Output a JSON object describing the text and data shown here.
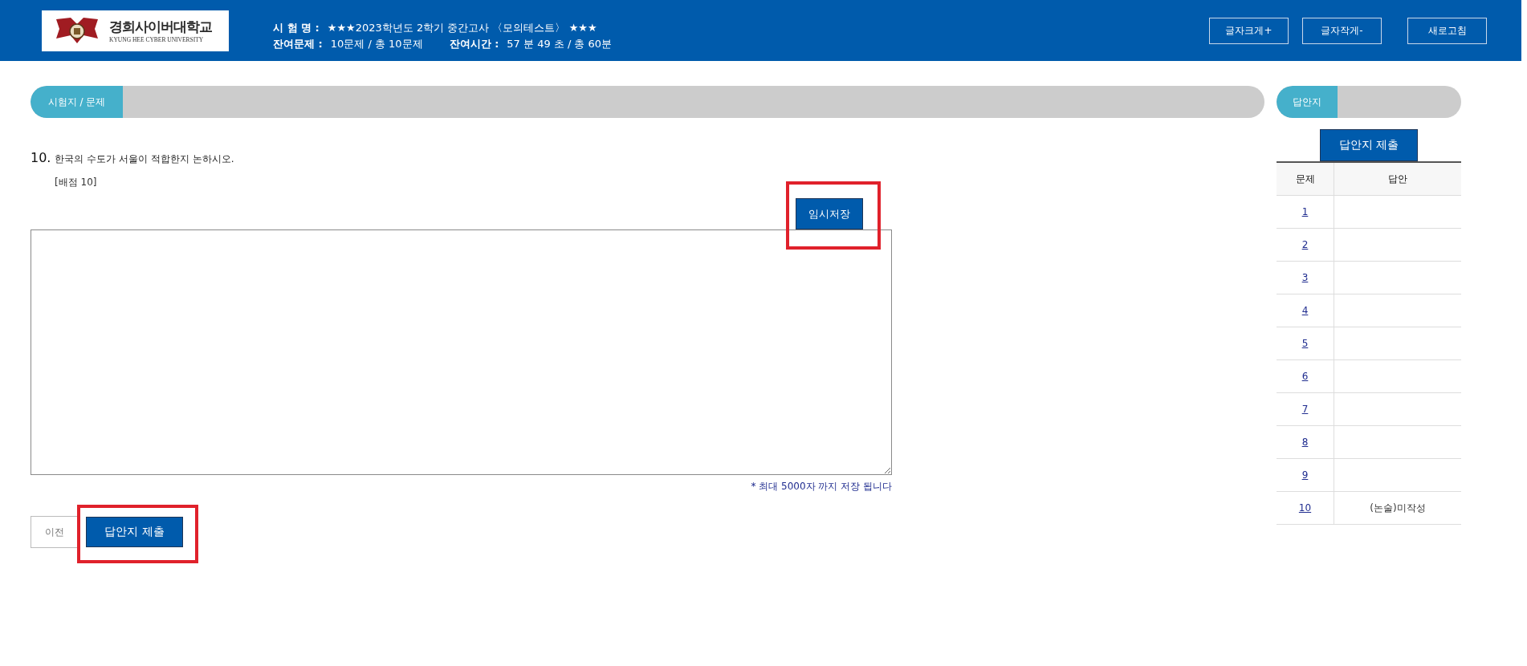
{
  "header": {
    "university_name": "경희사이버대학교",
    "university_name_en": "KYUNG HEE CYBER UNIVERSITY",
    "exam_label": "시 험 명 :",
    "exam_name": "★★★2023학년도 2학기 중간고사 〈모의테스트〉 ★★★",
    "remaining_questions_label": "잔여문제 :",
    "remaining_questions": "10문제 / 총 10문제",
    "remaining_time_label": "잔여시간 :",
    "remaining_time": "57 분 49 초 / 총 60분",
    "buttons": [
      {
        "label": "글자크게+"
      },
      {
        "label": "글자작게-"
      },
      {
        "label": "새로고침"
      }
    ]
  },
  "question_panel": {
    "tab": "시험지 / 문제",
    "number": "10.",
    "text": "한국의 수도가 서울이 적합한지 논하시오.",
    "points": "[배점 10]",
    "save_button": {
      "label": "임시저장",
      "highlighted": true
    },
    "note": "* 최대 5000자 까지 저장 됩니다",
    "prev_button": {
      "label": "이전"
    },
    "submit_button": {
      "label": "답안지 제출",
      "highlighted": true
    }
  },
  "answer_sheet": {
    "tab": "답안지",
    "submit_button": {
      "label": "답안지 제출"
    },
    "columns": [
      "문제",
      "답안"
    ],
    "rows": [
      {
        "question": "1"
      },
      {
        "question": "2"
      },
      {
        "question": "3"
      },
      {
        "question": "4"
      },
      {
        "question": "5"
      },
      {
        "question": "6"
      },
      {
        "question": "7"
      },
      {
        "question": "8"
      },
      {
        "question": "9"
      },
      {
        "question": "10",
        "answer": "(논술)미작성"
      }
    ]
  }
}
